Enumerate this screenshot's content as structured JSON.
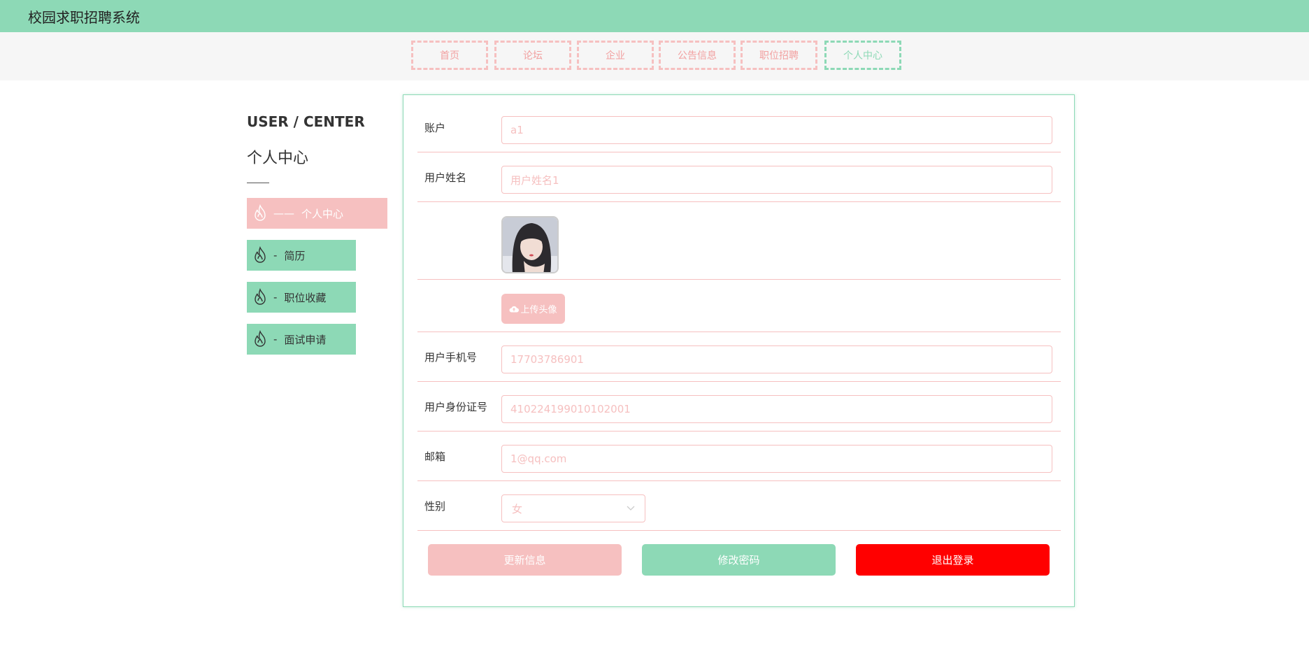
{
  "app": {
    "title": "校园求职招聘系统"
  },
  "nav": [
    {
      "label": "首页"
    },
    {
      "label": "论坛"
    },
    {
      "label": "企业"
    },
    {
      "label": "公告信息"
    },
    {
      "label": "职位招聘"
    },
    {
      "label": "个人中心",
      "active": true
    }
  ],
  "sidebar": {
    "heading_en": "USER / CENTER",
    "heading_cn": "个人中心",
    "items": [
      {
        "label": "个人中心",
        "prefix": "——",
        "active": true
      },
      {
        "label": "简历",
        "prefix": "-"
      },
      {
        "label": "职位收藏",
        "prefix": "-"
      },
      {
        "label": "面试申请",
        "prefix": "-"
      }
    ]
  },
  "form": {
    "account": {
      "label": "账户",
      "value": "a1"
    },
    "username": {
      "label": "用户姓名",
      "value": "用户姓名1"
    },
    "upload_label": "上传头像",
    "phone": {
      "label": "用户手机号",
      "value": "17703786901"
    },
    "idcard": {
      "label": "用户身份证号",
      "value": "410224199010102001"
    },
    "email": {
      "label": "邮箱",
      "value": "1@qq.com"
    },
    "gender": {
      "label": "性别",
      "value": "女"
    }
  },
  "buttons": {
    "update": "更新信息",
    "password": "修改密码",
    "logout": "退出登录"
  },
  "colors": {
    "green": "#8dd9b6",
    "pink": "#f6c0c0",
    "red": "#ff0000"
  }
}
